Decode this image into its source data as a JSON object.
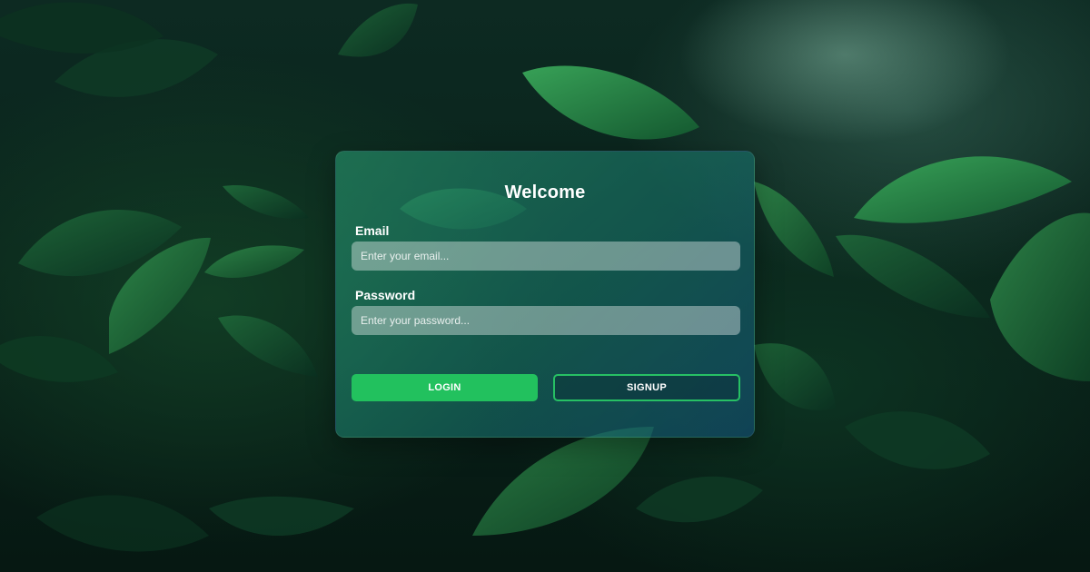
{
  "form": {
    "title": "Welcome",
    "email_label": "Email",
    "email_placeholder": "Enter your email...",
    "email_value": "",
    "password_label": "Password",
    "password_placeholder": "Enter your password...",
    "password_value": "",
    "login_label": "LOGIN",
    "signup_label": "SIGNUP"
  },
  "colors": {
    "login_button": "#22c15e",
    "signup_border": "#27c064",
    "card_tint": "#1f8a6e"
  },
  "background": {
    "description_icon": "leaves-background"
  }
}
